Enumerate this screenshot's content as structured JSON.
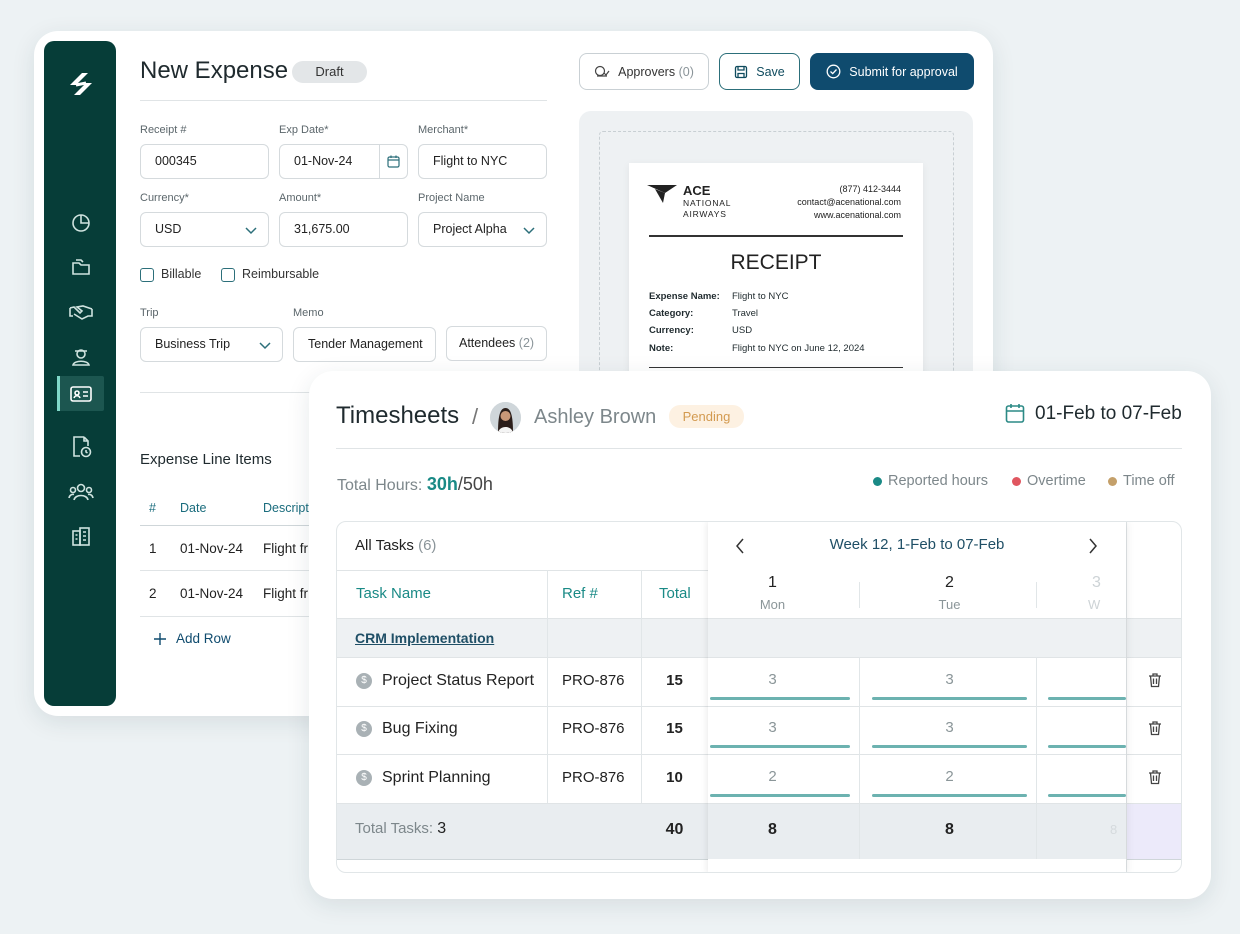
{
  "expense": {
    "title": "New Expense",
    "status": "Draft",
    "approvers_label": "Approvers",
    "approvers_count": "(0)",
    "save_label": "Save",
    "submit_label": "Submit for approval",
    "fields": {
      "receipt_label": "Receipt #",
      "receipt_value": "000345",
      "expdate_label": "Exp Date*",
      "expdate_value": "01-Nov-24",
      "merchant_label": "Merchant*",
      "merchant_value": "Flight to NYC",
      "currency_label": "Currency*",
      "currency_value": "USD",
      "amount_label": "Amount*",
      "amount_value": "31,675.00",
      "project_label": "Project Name",
      "project_value": "Project Alpha",
      "billable_label": "Billable",
      "reimbursable_label": "Reimbursable",
      "trip_label": "Trip",
      "trip_value": "Business Trip",
      "memo_label": "Memo",
      "memo_value": "Tender Management",
      "attendees_label": "Attendees",
      "attendees_count": "(2)"
    },
    "line_items": {
      "heading": "Expense Line Items",
      "columns": [
        "#",
        "Date",
        "Descript"
      ],
      "rows": [
        {
          "num": "1",
          "date": "01-Nov-24",
          "desc": "Flight fr"
        },
        {
          "num": "2",
          "date": "01-Nov-24",
          "desc": "Flight fr"
        }
      ],
      "add_row": "Add Row"
    },
    "receipt": {
      "brand": "ACE",
      "brand_sub1": "NATIONAL",
      "brand_sub2": "AIRWAYS",
      "phone": "(877) 412-3444",
      "email": "contact@acenational.com",
      "web": "www.acenational.com",
      "heading": "RECEIPT",
      "rows": [
        {
          "k": "Expense Name:",
          "v": "Flight to NYC"
        },
        {
          "k": "Category:",
          "v": "Travel"
        },
        {
          "k": "Currency:",
          "v": "USD"
        },
        {
          "k": "Note:",
          "v": "Flight to NYC on June 12, 2024"
        }
      ]
    },
    "sidebar_icons": [
      "logo-icon",
      "pie-chart-icon",
      "folders-icon",
      "handshake-icon",
      "user-badge-icon",
      "id-card-icon",
      "document-clock-icon",
      "users-icon",
      "building-icon"
    ]
  },
  "timesheet": {
    "title": "Timesheets",
    "employee": "Ashley Brown",
    "status": "Pending",
    "date_range": "01-Feb to 07-Feb",
    "total_hours_label": "Total Hours:",
    "total_hours_value": "30h",
    "total_hours_max": "/50h",
    "legend": [
      {
        "label": "Reported hours",
        "color": "#1a8a86"
      },
      {
        "label": "Overtime",
        "color": "#e05660"
      },
      {
        "label": "Time off",
        "color": "#c4a06a"
      }
    ],
    "all_tasks_label": "All Tasks",
    "all_tasks_count": "(6)",
    "week_label": "Week 12, 1-Feb to 07-Feb",
    "columns": {
      "task": "Task Name",
      "ref": "Ref #",
      "total": "Total"
    },
    "days": [
      {
        "num": "1",
        "name": "Mon"
      },
      {
        "num": "2",
        "name": "Tue"
      },
      {
        "num": "3",
        "name": "W"
      }
    ],
    "group": "CRM Implementation",
    "tasks": [
      {
        "name": "Project Status Report",
        "ref": "PRO-876",
        "total": "15",
        "d1": "3",
        "d2": "3"
      },
      {
        "name": "Bug Fixing",
        "ref": "PRO-876",
        "total": "15",
        "d1": "3",
        "d2": "3"
      },
      {
        "name": "Sprint Planning",
        "ref": "PRO-876",
        "total": "10",
        "d1": "2",
        "d2": "2"
      }
    ],
    "footer": {
      "label": "Total Tasks:",
      "count": "3",
      "total": "40",
      "d1": "8",
      "d2": "8",
      "d3": "8"
    }
  }
}
